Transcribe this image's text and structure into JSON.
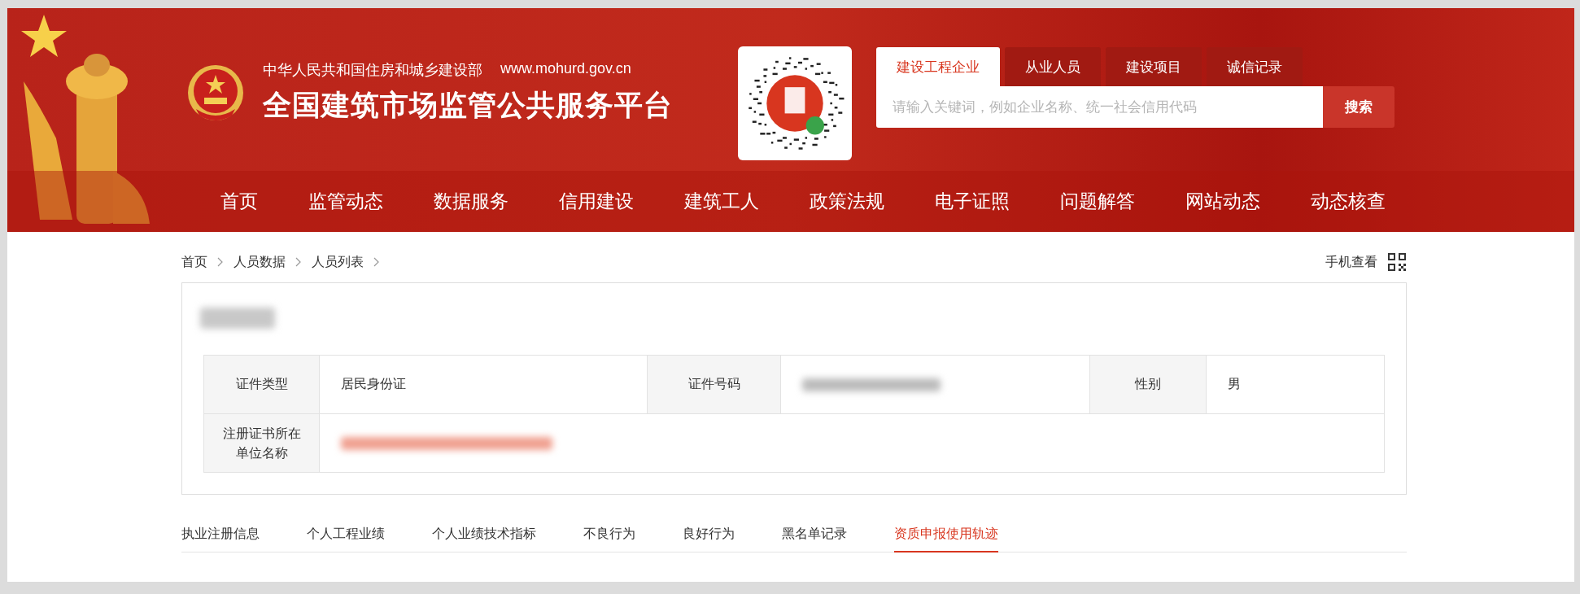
{
  "header": {
    "ministry": "中华人民共和国住房和城乡建设部",
    "website": "www.mohurd.gov.cn",
    "title": "全国建筑市场监管公共服务平台"
  },
  "search": {
    "tabs": [
      {
        "label": "建设工程企业",
        "selected": true
      },
      {
        "label": "从业人员",
        "selected": false
      },
      {
        "label": "建设项目",
        "selected": false
      },
      {
        "label": "诚信记录",
        "selected": false
      }
    ],
    "placeholder": "请输入关键词，例如企业名称、统一社会信用代码",
    "button": "搜索"
  },
  "nav": [
    "首页",
    "监管动态",
    "数据服务",
    "信用建设",
    "建筑工人",
    "政策法规",
    "电子证照",
    "问题解答",
    "网站动态",
    "动态核查"
  ],
  "breadcrumb": [
    "首页",
    "人员数据",
    "人员列表"
  ],
  "mobile_view": "手机查看",
  "person_table": {
    "id_type_label": "证件类型",
    "id_type": "居民身份证",
    "id_number_label": "证件号码",
    "gender_label": "性别",
    "gender": "男",
    "company_label": "注册证书所在单位名称"
  },
  "tabs": [
    {
      "label": "执业注册信息",
      "selected": false
    },
    {
      "label": "个人工程业绩",
      "selected": false
    },
    {
      "label": "个人业绩技术指标",
      "selected": false
    },
    {
      "label": "不良行为",
      "selected": false
    },
    {
      "label": "良好行为",
      "selected": false
    },
    {
      "label": "黑名单记录",
      "selected": false
    },
    {
      "label": "资质申报使用轨迹",
      "selected": true
    }
  ]
}
